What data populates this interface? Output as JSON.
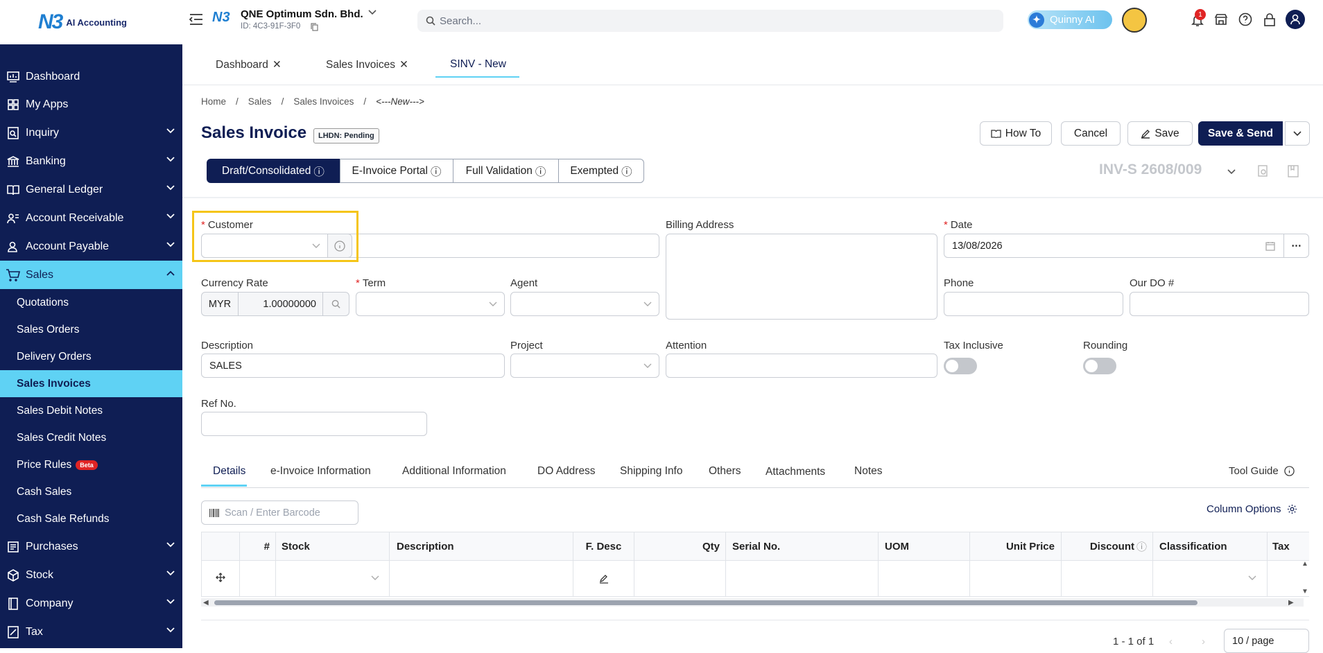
{
  "app": {
    "logo_text": "AI Accounting",
    "logo_mark": "N3"
  },
  "sidebar": {
    "items": [
      {
        "label": "Dashboard",
        "icon": "dashboard-icon"
      },
      {
        "label": "My Apps",
        "icon": "apps-icon"
      },
      {
        "label": "Inquiry",
        "icon": "inquiry-icon"
      },
      {
        "label": "Banking",
        "icon": "bank-icon"
      },
      {
        "label": "General Ledger",
        "icon": "ledger-icon"
      },
      {
        "label": "Account Receivable",
        "icon": "receivable-icon"
      },
      {
        "label": "Account Payable",
        "icon": "payable-icon"
      },
      {
        "label": "Sales",
        "icon": "cart-icon"
      }
    ],
    "sales_sub": [
      "Quotations",
      "Sales Orders",
      "Delivery Orders",
      "Sales Invoices",
      "Sales Debit Notes",
      "Sales Credit Notes",
      "Price Rules",
      "Cash Sales",
      "Cash Sale Refunds"
    ],
    "beta": "Beta",
    "bottom": [
      {
        "label": "Purchases",
        "icon": "purchases-icon"
      },
      {
        "label": "Stock",
        "icon": "box-icon"
      },
      {
        "label": "Company",
        "icon": "company-icon"
      },
      {
        "label": "Tax",
        "icon": "tax-icon"
      }
    ]
  },
  "topbar": {
    "company": "QNE Optimum Sdn. Bhd.",
    "company_id": "ID: 4C3-91F-3F0",
    "search_placeholder": "Search...",
    "quinny": "Quinny AI",
    "notif_count": "1"
  },
  "tabs": [
    {
      "label": "Dashboard"
    },
    {
      "label": "Sales Invoices"
    },
    {
      "label": "SINV - New"
    }
  ],
  "breadcrumb": [
    "Home",
    "Sales",
    "Sales Invoices",
    "<---New--->"
  ],
  "page": {
    "title": "Sales Invoice",
    "badge": "LHDN: Pending",
    "how_to": "How To",
    "cancel": "Cancel",
    "save": "Save",
    "save_send": "Save & Send",
    "invoice_no": "INV-S 2608/009"
  },
  "segments": [
    "Draft/Consolidated",
    "E-Invoice Portal",
    "Full Validation",
    "Exempted"
  ],
  "form": {
    "customer": "Customer",
    "billing": "Billing Address",
    "date": "Date",
    "date_value": "13/08/2026",
    "currency_rate": "Currency Rate",
    "currency": "MYR",
    "rate": "1.00000000",
    "term": "Term",
    "agent": "Agent",
    "phone": "Phone",
    "our_do": "Our DO #",
    "description": "Description",
    "description_value": "SALES",
    "project": "Project",
    "attention": "Attention",
    "tax_inclusive": "Tax Inclusive",
    "rounding": "Rounding",
    "ref_no": "Ref No."
  },
  "detail_tabs": [
    "Details",
    "e-Invoice Information",
    "Additional Information",
    "DO Address",
    "Shipping Info",
    "Others",
    "Attachments",
    "Notes"
  ],
  "tool_guide": "Tool Guide",
  "barcode_placeholder": "Scan / Enter Barcode",
  "column_options": "Column Options",
  "table": {
    "headers": [
      "#",
      "Stock",
      "Description",
      "F. Desc",
      "Qty",
      "Serial No.",
      "UOM",
      "Unit Price",
      "Discount",
      "Classification",
      "Tax"
    ]
  },
  "pagination": {
    "range": "1 - 1 of 1",
    "page_size": "10 / page"
  },
  "colors": {
    "navy": "#0f1e54",
    "accent": "#5fd2f4",
    "highlight": "#f5c518"
  }
}
